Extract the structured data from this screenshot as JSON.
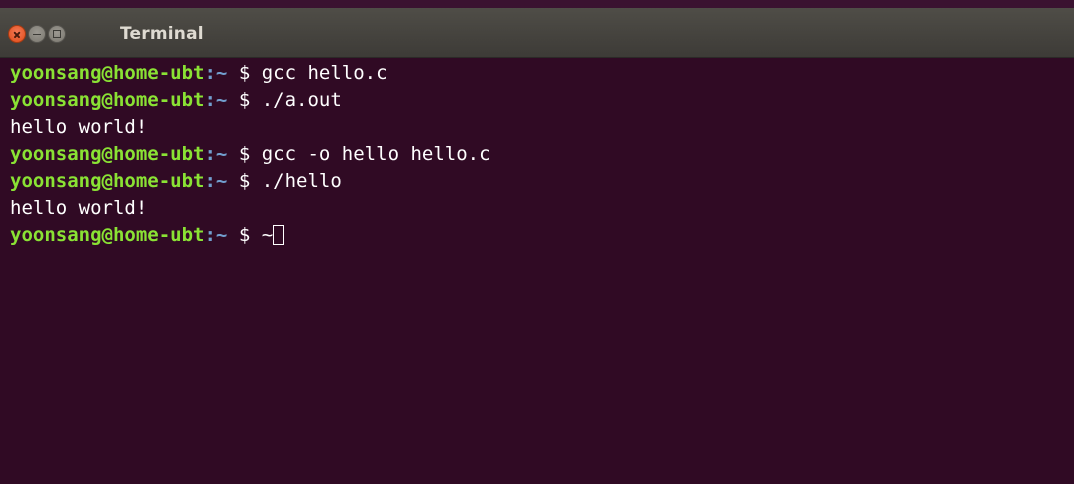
{
  "window": {
    "title": "Terminal"
  },
  "terminal": {
    "lines": [
      {
        "type": "prompt",
        "user_host": "yoonsang@home-ubt",
        "path": "~",
        "symbol": "$",
        "command": "gcc hello.c"
      },
      {
        "type": "prompt",
        "user_host": "yoonsang@home-ubt",
        "path": "~",
        "symbol": "$",
        "command": "./a.out"
      },
      {
        "type": "output",
        "text": "hello world!"
      },
      {
        "type": "prompt",
        "user_host": "yoonsang@home-ubt",
        "path": "~",
        "symbol": "$",
        "command": "gcc -o hello hello.c"
      },
      {
        "type": "prompt",
        "user_host": "yoonsang@home-ubt",
        "path": "~",
        "symbol": "$",
        "command": "./hello"
      },
      {
        "type": "output",
        "text": "hello world!"
      },
      {
        "type": "prompt",
        "user_host": "yoonsang@home-ubt",
        "path": "~",
        "symbol": "$",
        "command": "~",
        "has_cursor": true
      }
    ]
  },
  "colors": {
    "background": "#300a24",
    "user_host": "#8ae234",
    "path": "#729fcf",
    "text": "#ffffff",
    "close_button": "#df4b16"
  },
  "icons": {
    "close": "close-icon",
    "minimize": "minimize-icon",
    "maximize": "maximize-icon"
  }
}
